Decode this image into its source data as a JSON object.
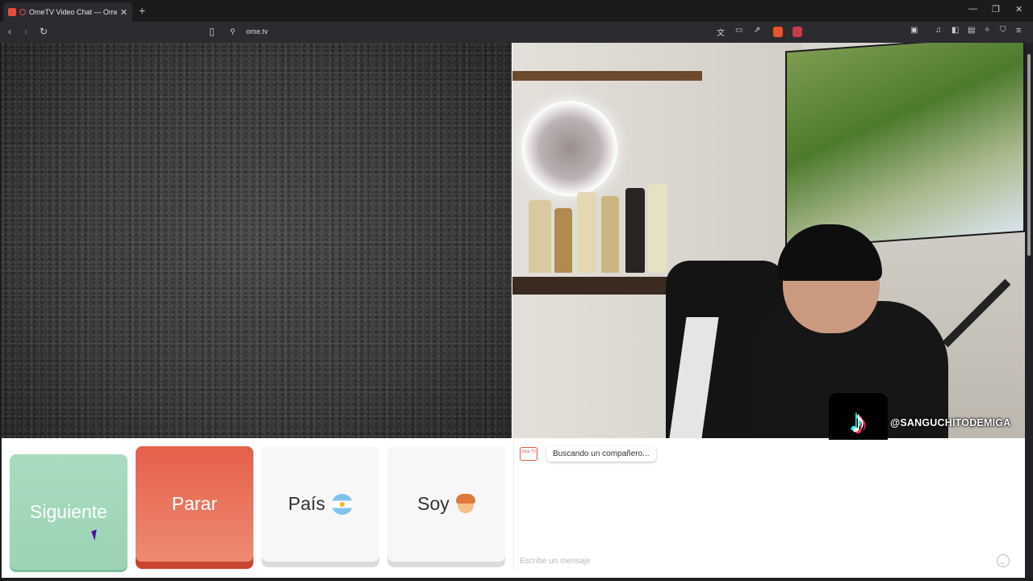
{
  "browser": {
    "tab_title": "OmeTV Video Chat — Omeg",
    "tab_close": "✕",
    "new_tab": "+",
    "url": "ome.tv",
    "window_controls": {
      "minimize": "—",
      "maximize": "❐",
      "close": "✕"
    },
    "icons": [
      "back-icon",
      "forward-icon",
      "reload-icon",
      "bookmark-icon",
      "site-info-icon",
      "translate-icon",
      "cast-icon",
      "share-icon",
      "brave-shield-icon",
      "rewards-icon",
      "sidebar-icon",
      "media-icon",
      "wallet-icon",
      "leo-icon",
      "vpn-icon",
      "menu-icon"
    ]
  },
  "controls": {
    "next_label": "Siguiente",
    "stop_label": "Parar",
    "country_label": "País",
    "gender_label": "Soy",
    "next_color": "#9bd3b4",
    "stop_color": "#e5604b"
  },
  "chat": {
    "logo_text": "Ome TV",
    "status_message": "Buscando un compañero...",
    "input_placeholder": "Escribe un mensaje"
  },
  "overlay": {
    "tiktok_handle": "@SANGUCHITODEMIGA"
  }
}
